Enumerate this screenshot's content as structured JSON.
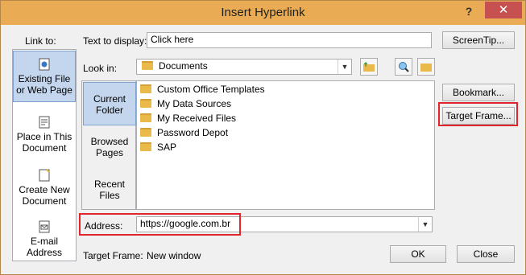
{
  "window": {
    "title": "Insert Hyperlink",
    "help": "?",
    "close": "✕"
  },
  "link_to": {
    "label": "Link to:",
    "items": [
      {
        "line1": "Existing File",
        "line2": "or Web Page",
        "icon": "globe-page-icon"
      },
      {
        "line1": "Place in This",
        "line2": "Document",
        "icon": "document-place-icon"
      },
      {
        "line1": "Create New",
        "line2": "Document",
        "icon": "new-document-icon"
      },
      {
        "line1": "E-mail",
        "line2": "Address",
        "icon": "email-icon"
      }
    ]
  },
  "text_to_display": {
    "label": "Text to display:",
    "value": "Click here"
  },
  "screentip": {
    "label": "ScreenTip..."
  },
  "look_in": {
    "label": "Look in:",
    "value": "Documents"
  },
  "sub_items": [
    {
      "line1": "Current",
      "line2": "Folder"
    },
    {
      "line1": "Browsed",
      "line2": "Pages"
    },
    {
      "line1": "Recent",
      "line2": "Files"
    }
  ],
  "files": [
    {
      "name": "Custom Office Templates",
      "icon": "folder-icon"
    },
    {
      "name": "My Data Sources",
      "icon": "data-source-folder-icon"
    },
    {
      "name": "My Received Files",
      "icon": "folder-icon"
    },
    {
      "name": "Password Depot",
      "icon": "folder-icon"
    },
    {
      "name": "SAP",
      "icon": "folder-icon"
    }
  ],
  "bookmark": {
    "label": "Bookmark..."
  },
  "target_frame_btn": {
    "label": "Target Frame..."
  },
  "address": {
    "label": "Address:",
    "value": "https://google.com.br"
  },
  "target_frame_info": {
    "label": "Target Frame:",
    "value": "New window"
  },
  "ok": {
    "label": "OK"
  },
  "cancel": {
    "label": "Close"
  },
  "colors": {
    "accent": "#e9ac54",
    "selection": "#c4d6ee",
    "highlight": "#e0262c"
  }
}
